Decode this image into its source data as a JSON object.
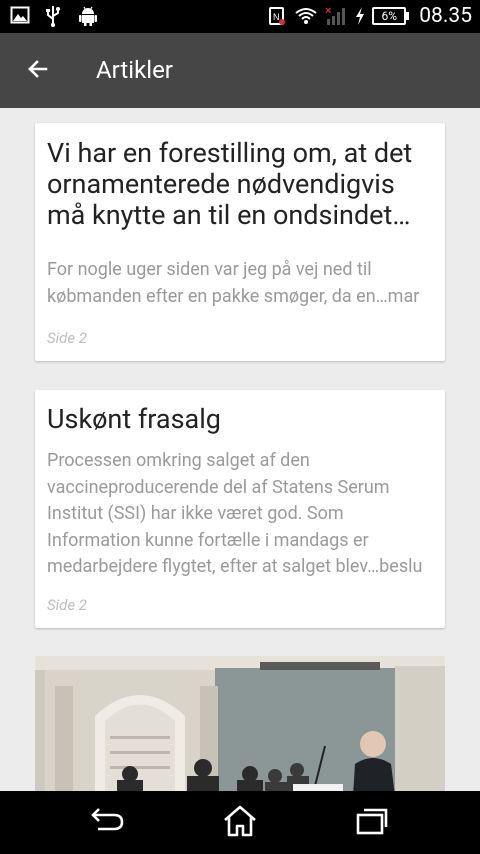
{
  "status_bar": {
    "time": "08.35",
    "battery": "6%",
    "icons": [
      "image-icon",
      "usb-icon",
      "android-icon",
      "nfc-icon",
      "wifi-icon",
      "signal-icon",
      "charging-icon"
    ]
  },
  "toolbar": {
    "title": "Artikler",
    "back_icon": "arrow-left-icon",
    "background": "#464646"
  },
  "articles": [
    {
      "title": "Vi har en forestilling om, at det ornamenterede nødvendigvis må knytte an til en ondsindet…",
      "excerpt": "For nogle uger siden var jeg på vej ned til købmanden efter en pakke smøger, da en…mar",
      "page": "Side 2"
    },
    {
      "title": "Uskønt frasalg",
      "excerpt": "Processen omkring salget af den vaccineproducerende del af Statens Serum Institut (SSI) har ikke været god. Som Information kunne fortælle i mandags er medarbejdere flygtet, efter at salget blev…beslu",
      "page": "Side 2"
    }
  ],
  "nav_bar": {
    "icons": [
      "back-icon",
      "home-icon",
      "recents-icon"
    ]
  }
}
